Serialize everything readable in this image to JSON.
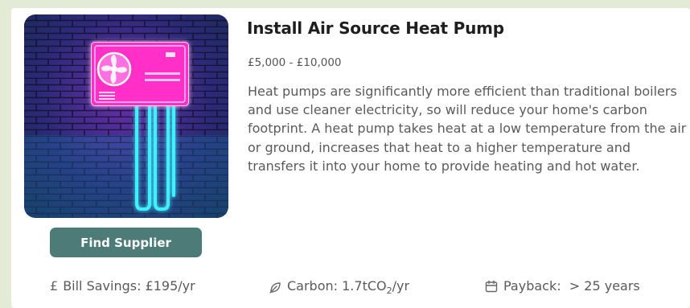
{
  "card": {
    "title": "Install Air Source Heat Pump",
    "price_range": "£5,000 - £10,000",
    "description": "Heat pumps are significantly more efficient than traditional boilers and use cleaner electricity, so will reduce your home's carbon footprint. A heat pump takes heat at a low temperature from the air or ground, increases that heat to a higher temperature and transfers it into your home to provide heating and hot water.",
    "image": {
      "alt": "heat-pump-neon-illustration",
      "colors": {
        "unit": "#ff2fd6",
        "pipes": "#2fe8ff",
        "bricks": "#3b2a6e"
      }
    },
    "button_label": "Find Supplier",
    "stats": {
      "savings": {
        "icon": "pound-icon",
        "label": "Bill Savings: £195/yr"
      },
      "carbon": {
        "icon": "leaf-icon",
        "prefix": "Carbon: 1.7tCO",
        "subscript": "2",
        "suffix": "/yr"
      },
      "payback": {
        "icon": "calendar-icon",
        "label": "Payback:  > 25 years"
      }
    }
  },
  "colors": {
    "page_background": "#e3ebd6",
    "card_background": "#ffffff",
    "button": "#4c7b78",
    "title_text": "#1e1e1e",
    "body_text": "#5a5a5a"
  }
}
